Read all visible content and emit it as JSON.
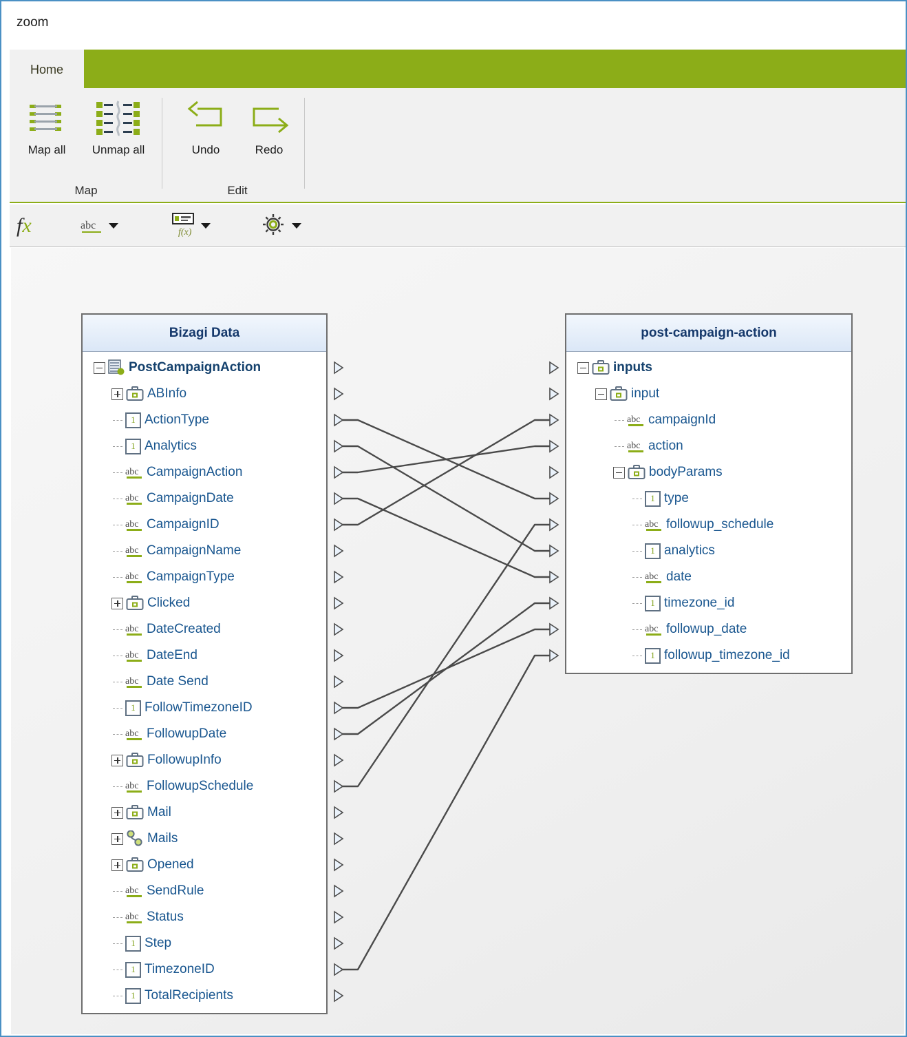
{
  "window": {
    "title": "zoom"
  },
  "theme": {
    "accent": "#8cad18",
    "node_text": "#19568f",
    "panel_header_text": "#15386b"
  },
  "ribbon": {
    "tabs": [
      {
        "label": "Home",
        "active": true
      }
    ],
    "groups": [
      {
        "name": "Map",
        "label": "Map",
        "buttons": [
          {
            "label": "Map all",
            "icon": "map-all-icon"
          },
          {
            "label": "Unmap all",
            "icon": "unmap-all-icon"
          }
        ]
      },
      {
        "name": "Edit",
        "label": "Edit",
        "buttons": [
          {
            "label": "Undo",
            "icon": "undo-icon"
          },
          {
            "label": "Redo",
            "icon": "redo-icon"
          }
        ]
      }
    ]
  },
  "toolbar": {
    "items": [
      {
        "name": "function-button",
        "icon": "fx-icon",
        "label": "fx",
        "has_caret": false
      },
      {
        "name": "text-transform",
        "icon": "abc-icon",
        "label": "abc",
        "has_caret": true
      },
      {
        "name": "expression-tool",
        "icon": "expression-icon",
        "label": "",
        "has_caret": true
      },
      {
        "name": "settings-tool",
        "icon": "gear-icon",
        "label": "",
        "has_caret": true
      }
    ]
  },
  "panels": {
    "left": {
      "title": "Bizagi Data",
      "nodes": [
        {
          "label": "PostCampaignAction",
          "icon": "entity-icon",
          "indent": 0,
          "twisty": "minus",
          "connected": false
        },
        {
          "label": "ABInfo",
          "icon": "case-icon",
          "indent": 1,
          "twisty": "plus",
          "connected": false
        },
        {
          "label": "ActionType",
          "icon": "number-icon",
          "indent": 1,
          "twisty": "leaf",
          "connected": true
        },
        {
          "label": "Analytics",
          "icon": "number-icon",
          "indent": 1,
          "twisty": "leaf",
          "connected": true
        },
        {
          "label": "CampaignAction",
          "icon": "abc-icon",
          "indent": 1,
          "twisty": "leaf",
          "connected": true
        },
        {
          "label": "CampaignDate",
          "icon": "abc-icon",
          "indent": 1,
          "twisty": "leaf",
          "connected": true
        },
        {
          "label": "CampaignID",
          "icon": "abc-icon",
          "indent": 1,
          "twisty": "leaf",
          "connected": true
        },
        {
          "label": "CampaignName",
          "icon": "abc-icon",
          "indent": 1,
          "twisty": "leaf",
          "connected": false
        },
        {
          "label": "CampaignType",
          "icon": "abc-icon",
          "indent": 1,
          "twisty": "leaf",
          "connected": false
        },
        {
          "label": "Clicked",
          "icon": "case-icon",
          "indent": 1,
          "twisty": "plus",
          "connected": false
        },
        {
          "label": "DateCreated",
          "icon": "abc-icon",
          "indent": 1,
          "twisty": "leaf",
          "connected": false
        },
        {
          "label": "DateEnd",
          "icon": "abc-icon",
          "indent": 1,
          "twisty": "leaf",
          "connected": false
        },
        {
          "label": "Date Send",
          "icon": "abc-icon",
          "indent": 1,
          "twisty": "leaf",
          "connected": false
        },
        {
          "label": "FollowTimezoneID",
          "icon": "number-icon",
          "indent": 1,
          "twisty": "leaf",
          "connected": true
        },
        {
          "label": "FollowupDate",
          "icon": "abc-icon",
          "indent": 1,
          "twisty": "leaf",
          "connected": true
        },
        {
          "label": "FollowupInfo",
          "icon": "case-icon",
          "indent": 1,
          "twisty": "plus",
          "connected": false
        },
        {
          "label": "FollowupSchedule",
          "icon": "abc-icon",
          "indent": 1,
          "twisty": "leaf",
          "connected": true
        },
        {
          "label": "Mail",
          "icon": "case-icon",
          "indent": 1,
          "twisty": "plus",
          "connected": false
        },
        {
          "label": "Mails",
          "icon": "collection-icon",
          "indent": 1,
          "twisty": "plus",
          "connected": false
        },
        {
          "label": "Opened",
          "icon": "case-icon",
          "indent": 1,
          "twisty": "plus",
          "connected": false
        },
        {
          "label": "SendRule",
          "icon": "abc-icon",
          "indent": 1,
          "twisty": "leaf",
          "connected": false
        },
        {
          "label": "Status",
          "icon": "abc-icon",
          "indent": 1,
          "twisty": "leaf",
          "connected": false
        },
        {
          "label": "Step",
          "icon": "number-icon",
          "indent": 1,
          "twisty": "leaf",
          "connected": false
        },
        {
          "label": "TimezoneID",
          "icon": "number-icon",
          "indent": 1,
          "twisty": "leaf",
          "connected": true
        },
        {
          "label": "TotalRecipients",
          "icon": "number-icon",
          "indent": 1,
          "twisty": "leaf",
          "connected": false
        }
      ]
    },
    "right": {
      "title": "post-campaign-action",
      "nodes": [
        {
          "label": "inputs",
          "icon": "case-icon",
          "indent": 0,
          "twisty": "minus",
          "connected": false
        },
        {
          "label": "input",
          "icon": "case-icon",
          "indent": 1,
          "twisty": "minus",
          "connected": false
        },
        {
          "label": "campaignId",
          "icon": "abc-icon",
          "indent": 2,
          "twisty": "leaf",
          "connected": true
        },
        {
          "label": "action",
          "icon": "abc-icon",
          "indent": 2,
          "twisty": "leaf",
          "connected": true
        },
        {
          "label": "bodyParams",
          "icon": "case-icon",
          "indent": 2,
          "twisty": "minus",
          "connected": false
        },
        {
          "label": "type",
          "icon": "number-icon",
          "indent": 3,
          "twisty": "leaf",
          "connected": true
        },
        {
          "label": "followup_schedule",
          "icon": "abc-icon",
          "indent": 3,
          "twisty": "leaf",
          "connected": true
        },
        {
          "label": "analytics",
          "icon": "number-icon",
          "indent": 3,
          "twisty": "leaf",
          "connected": true
        },
        {
          "label": "date",
          "icon": "abc-icon",
          "indent": 3,
          "twisty": "leaf",
          "connected": true
        },
        {
          "label": "timezone_id",
          "icon": "number-icon",
          "indent": 3,
          "twisty": "leaf",
          "connected": true
        },
        {
          "label": "followup_date",
          "icon": "abc-icon",
          "indent": 3,
          "twisty": "leaf",
          "connected": true
        },
        {
          "label": "followup_timezone_id",
          "icon": "number-icon",
          "indent": 3,
          "twisty": "leaf",
          "connected": true
        }
      ]
    }
  },
  "mappings": [
    {
      "source": "ActionType",
      "target": "type"
    },
    {
      "source": "Analytics",
      "target": "analytics"
    },
    {
      "source": "CampaignAction",
      "target": "action"
    },
    {
      "source": "CampaignDate",
      "target": "date"
    },
    {
      "source": "CampaignID",
      "target": "campaignId"
    },
    {
      "source": "FollowTimezoneID",
      "target": "followup_date"
    },
    {
      "source": "FollowupDate",
      "target": "timezone_id"
    },
    {
      "source": "FollowupSchedule",
      "target": "followup_schedule"
    },
    {
      "source": "TimezoneID",
      "target": "followup_timezone_id"
    }
  ]
}
